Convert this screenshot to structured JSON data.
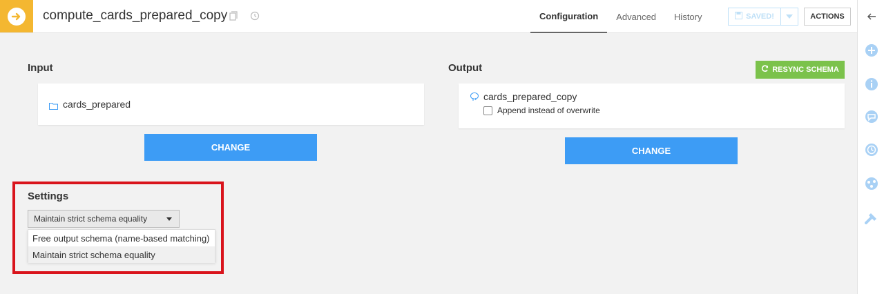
{
  "header": {
    "title": "compute_cards_prepared_copy",
    "tabs": [
      {
        "label": "Configuration",
        "active": true
      },
      {
        "label": "Advanced",
        "active": false
      },
      {
        "label": "History",
        "active": false
      }
    ],
    "saved_label": "SAVED!",
    "actions_label": "ACTIONS",
    "badge_color": "#f4b731"
  },
  "input": {
    "section_title": "Input",
    "dataset": "cards_prepared",
    "change_label": "CHANGE"
  },
  "output": {
    "section_title": "Output",
    "resync_label": "RESYNC SCHEMA",
    "dataset": "cards_prepared_copy",
    "append_label": "Append instead of overwrite",
    "append_checked": false,
    "change_label": "CHANGE"
  },
  "settings": {
    "section_title": "Settings",
    "selected": "Maintain strict schema equality",
    "options": [
      "Free output schema (name-based matching)",
      "Maintain strict schema equality"
    ]
  },
  "sidebar_icons": [
    "back-arrow-icon",
    "plus-icon",
    "info-icon",
    "chat-icon",
    "clock-icon",
    "flow-icon",
    "hammer-icon"
  ],
  "colors": {
    "accent": "#3d9cf5",
    "resync": "#7bc24b",
    "highlight": "#d9141c",
    "sidebar_icon": "#a9d1f5"
  }
}
